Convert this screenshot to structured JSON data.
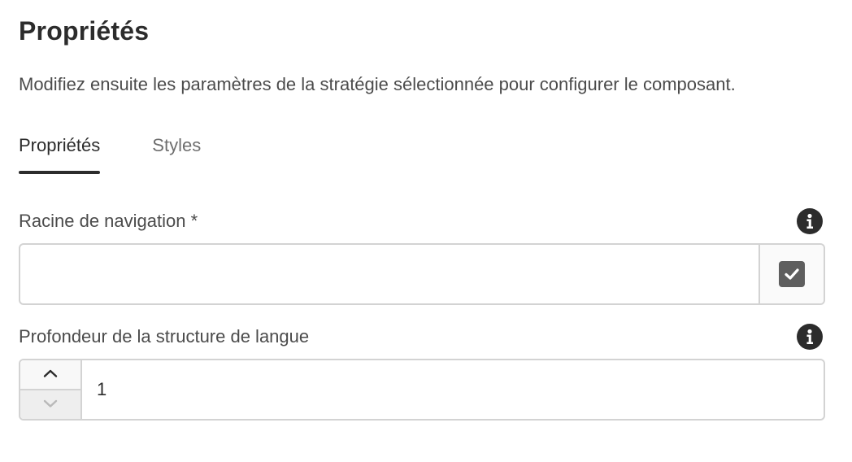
{
  "title": "Propriétés",
  "description": "Modifiez ensuite les paramètres de la stratégie sélectionnée pour configurer le composant.",
  "tabs": [
    {
      "label": "Propriétés",
      "active": true
    },
    {
      "label": "Styles",
      "active": false
    }
  ],
  "fields": {
    "navigation_root": {
      "label": "Racine de navigation *",
      "value": "",
      "placeholder": "",
      "icon": "info-icon",
      "button_icon": "checkmark-icon"
    },
    "language_depth": {
      "label": "Profondeur de la structure de langue",
      "value": "1",
      "icon": "info-icon",
      "stepper_icons": [
        "chevron-up-icon",
        "chevron-down-icon"
      ]
    }
  },
  "colors": {
    "text": "#2c2c2c",
    "muted": "#6e6e6e",
    "border": "#d3d3d3",
    "icon": "#2c2c2c"
  }
}
